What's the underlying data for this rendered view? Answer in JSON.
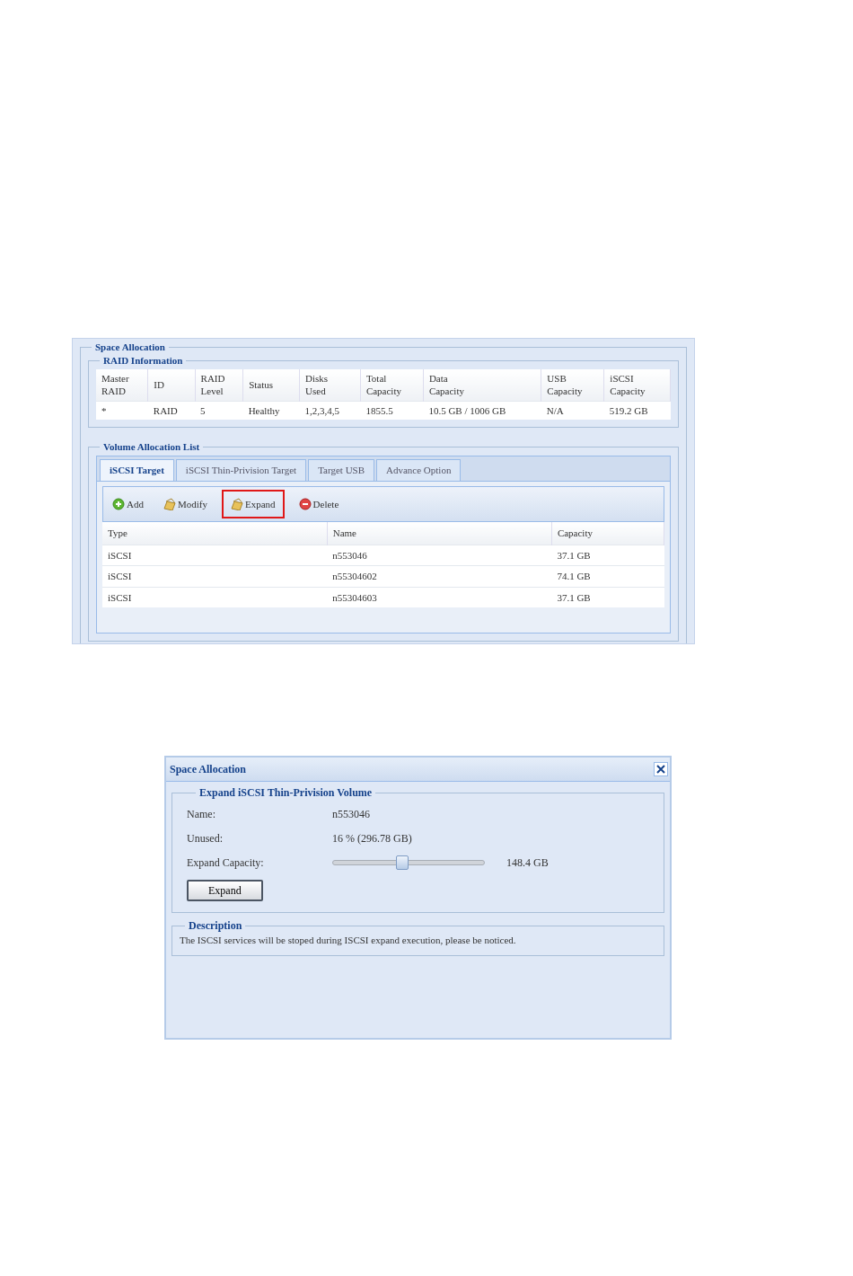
{
  "panel": {
    "title": "Space Allocation",
    "raid_info": {
      "title": "RAID Information",
      "columns": [
        "Master\nRAID",
        "ID",
        "RAID\nLevel",
        "Status",
        "Disks\nUsed",
        "Total\nCapacity",
        "Data\nCapacity",
        "USB\nCapacity",
        "iSCSI\nCapacity"
      ],
      "rows": [
        [
          "*",
          "RAID",
          "5",
          "Healthy",
          "1,2,3,4,5",
          "1855.5",
          "10.5 GB / 1006 GB",
          "N/A",
          "519.2 GB"
        ]
      ]
    },
    "volume_list": {
      "title": "Volume Allocation List",
      "tabs": [
        {
          "label": "iSCSI Target",
          "selected": true
        },
        {
          "label": "iSCSI Thin-Privision Target",
          "selected": false
        },
        {
          "label": "Target USB",
          "selected": false
        },
        {
          "label": "Advance Option",
          "selected": false
        }
      ],
      "toolbar": [
        {
          "kind": "add",
          "label": "Add",
          "highlighted": false
        },
        {
          "kind": "modify",
          "label": "Modify",
          "highlighted": false
        },
        {
          "kind": "expand",
          "label": "Expand",
          "highlighted": true
        },
        {
          "kind": "delete",
          "label": "Delete",
          "highlighted": false
        }
      ],
      "columns": [
        "Type",
        "Name",
        "Capacity"
      ],
      "rows": [
        [
          "iSCSI",
          "n553046",
          "37.1 GB"
        ],
        [
          "iSCSI",
          "n55304602",
          "74.1 GB"
        ],
        [
          "iSCSI",
          "n55304603",
          "37.1 GB"
        ]
      ]
    }
  },
  "dialog": {
    "title": "Space Allocation",
    "section_title": "Expand iSCSI Thin-Privision Volume",
    "fields": [
      {
        "kind": "text",
        "label": "Name:",
        "value": "n553046"
      },
      {
        "kind": "text",
        "label": "Unused:",
        "value": "16 % (296.78 GB)"
      },
      {
        "kind": "slider",
        "label": "Expand Capacity:",
        "level": 0.46,
        "reading": "148.4 GB"
      }
    ],
    "button": "Expand",
    "description": {
      "title": "Description",
      "text": "The ISCSI services will be stoped during ISCSI expand execution, please be noticed."
    }
  }
}
